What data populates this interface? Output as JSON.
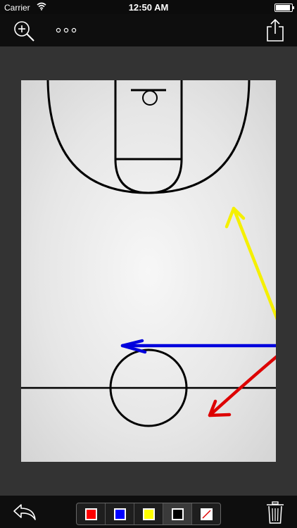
{
  "status_bar": {
    "carrier": "Carrier",
    "time": "12:50 AM",
    "battery_level": 1.0,
    "icons": [
      "wifi-icon",
      "battery-icon"
    ]
  },
  "toolbar": {
    "icons": [
      "zoom-in-icon",
      "more-icon",
      "share-icon"
    ]
  },
  "court": {
    "type": "half-court",
    "drawn_arrows": [
      {
        "color": "#ffff00",
        "direction": "up-left"
      },
      {
        "color": "#0000dd",
        "direction": "left"
      },
      {
        "color": "#dd0000",
        "direction": "down-left"
      }
    ]
  },
  "bottom_bar": {
    "icons": [
      "undo-icon",
      "trash-icon"
    ],
    "palette": [
      {
        "name": "red",
        "hex": "#ff0000",
        "selected": false
      },
      {
        "name": "blue",
        "hex": "#0000ff",
        "selected": false
      },
      {
        "name": "yellow",
        "hex": "#ffff00",
        "selected": false
      },
      {
        "name": "black",
        "hex": "#000000",
        "selected": true
      },
      {
        "name": "eraser",
        "hex": "#ffffff",
        "selected": false
      }
    ]
  },
  "colors": {
    "bar_background": "#0e0e0e",
    "frame_background": "#333333",
    "court_lines": "#000000"
  }
}
